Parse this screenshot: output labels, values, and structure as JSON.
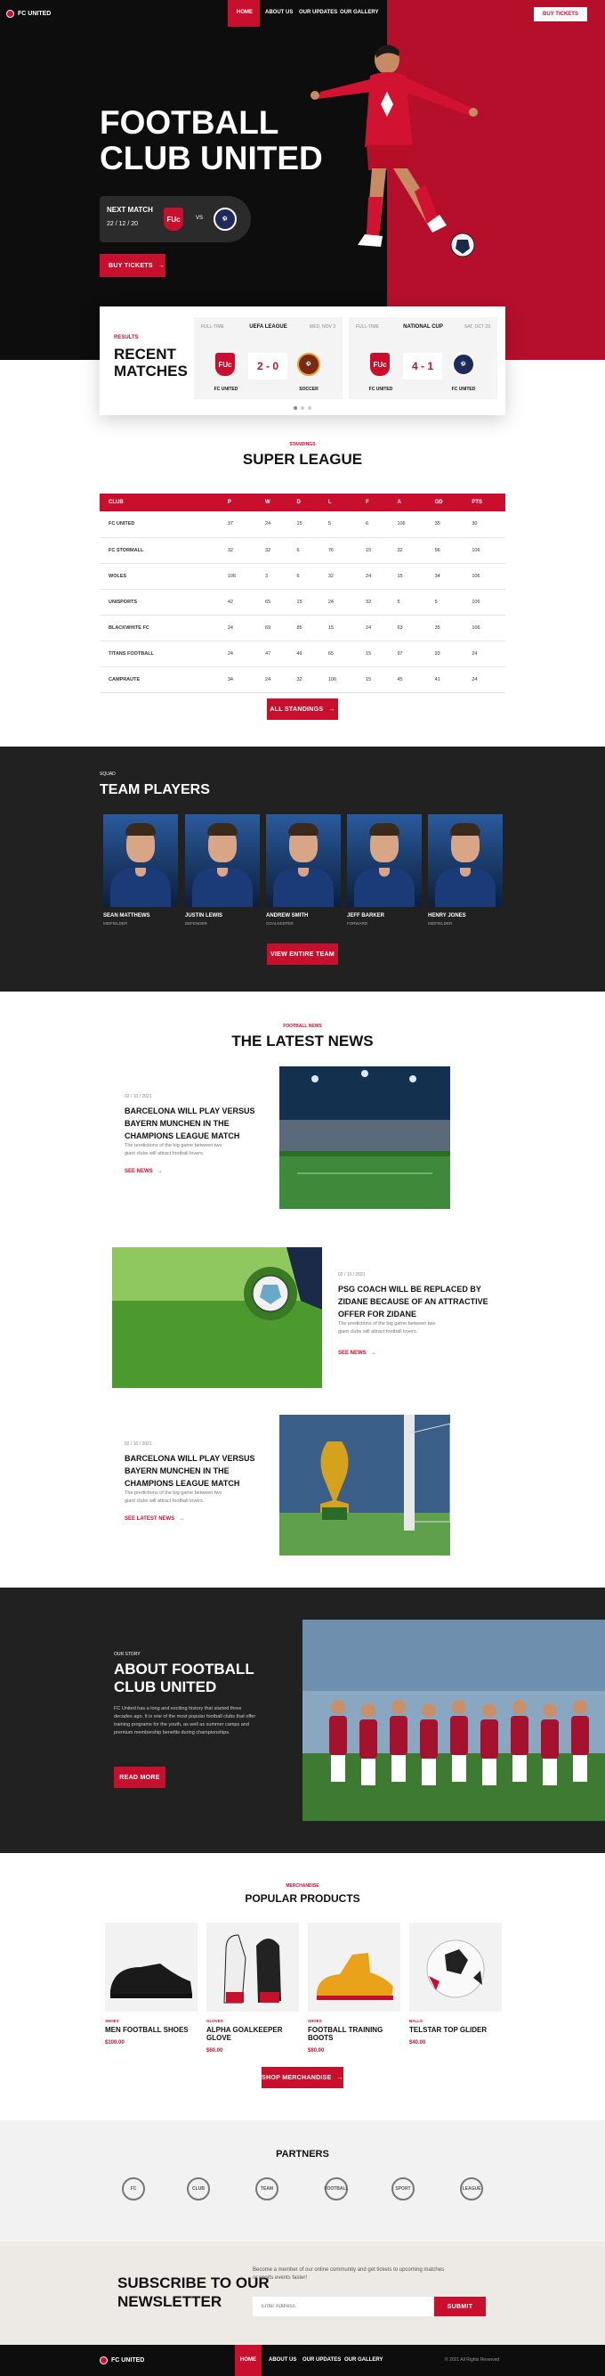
{
  "nav": {
    "brand": "FC UNITED",
    "items": [
      "HOME",
      "ABOUT US",
      "OUR UPDATES",
      "OUR GALLERY"
    ],
    "cta": "BUY TICKETS"
  },
  "hero": {
    "title_line1": "FOOTBALL",
    "title_line2": "CLUB UNITED",
    "next_match_label": "NEXT MATCH",
    "next_match_date": "22 / 12 / 20",
    "vs": "VS",
    "home_crest": "FUc",
    "buy_button": "BUY TICKETS"
  },
  "recent": {
    "kicker": "RESULTS",
    "title_line1": "RECENT",
    "title_line2": "MATCHES",
    "matches": [
      {
        "left_meta": "FULL-TIME",
        "competition": "UEFA LEAGUE",
        "right_meta": "WED, NOV 3",
        "score": "2 - 0",
        "team_a": "FC UNITED",
        "team_b": "SOCCER",
        "crest_a": "FUc"
      },
      {
        "left_meta": "FULL-TIME",
        "competition": "NATIONAL CUP",
        "right_meta": "SAT, OCT 23",
        "score": "4 - 1",
        "team_a": "FC UNITED",
        "team_b": "FC UNITED",
        "crest_a": "FUc"
      }
    ]
  },
  "standings": {
    "kicker": "STANDINGS",
    "title": "SUPER LEAGUE",
    "headers": [
      "CLUB",
      "P",
      "W",
      "D",
      "L",
      "F",
      "A",
      "GD",
      "PTS"
    ],
    "rows": [
      [
        "FC UNITED",
        "37",
        "24",
        "15",
        "5",
        "6",
        "106",
        "35",
        "30"
      ],
      [
        "FC STORMALL",
        "32",
        "32",
        "6",
        "76",
        "15",
        "32",
        "96",
        "106"
      ],
      [
        "WOLES",
        "106",
        "3",
        "6",
        "32",
        "24",
        "15",
        "34",
        "106"
      ],
      [
        "UNISPORTS",
        "42",
        "65",
        "15",
        "24",
        "32",
        "5",
        "5",
        "106"
      ],
      [
        "BLACKWHITE FC",
        "24",
        "69",
        "85",
        "15",
        "24",
        "63",
        "35",
        "106"
      ],
      [
        "TITANS FOOTBALL",
        "24",
        "47",
        "49",
        "65",
        "15",
        "97",
        "93",
        "24"
      ],
      [
        "CAMPRAUTE",
        "34",
        "24",
        "32",
        "106",
        "15",
        "45",
        "41",
        "24"
      ]
    ],
    "button": "ALL STANDINGS"
  },
  "players": {
    "kicker": "SQUAD",
    "title": "TEAM PLAYERS",
    "list": [
      {
        "name": "SEAN MATTHEWS",
        "position": "MIDFIELDER"
      },
      {
        "name": "JUSTIN LEWIS",
        "position": "DEFENDER"
      },
      {
        "name": "ANDREW SMITH",
        "position": "GOALKEEPER"
      },
      {
        "name": "JEFF BARKER",
        "position": "FORWARD"
      },
      {
        "name": "HENRY JONES",
        "position": "MIDFIELDER"
      }
    ],
    "button": "VIEW ENTIRE TEAM"
  },
  "news": {
    "kicker": "FOOTBALL NEWS",
    "title": "THE LATEST NEWS",
    "items": [
      {
        "date": "02 / 10 / 2021",
        "title": "BARCELONA WILL PLAY VERSUS BAYERN MUNCHEN IN THE CHAMPIONS LEAGUE MATCH",
        "desc": "The predictions of the big game between two giant clubs will attract football lovers.",
        "link": "SEE NEWS"
      },
      {
        "date": "02 / 10 / 2021",
        "title": "PSG COACH WILL BE REPLACED BY ZIDANE BECAUSE OF AN ATTRACTIVE OFFER FOR ZIDANE",
        "desc": "The predictions of the big game between two giant clubs will attract football lovers.",
        "link": "SEE NEWS"
      },
      {
        "date": "02 / 10 / 2021",
        "title": "BARCELONA WILL PLAY VERSUS BAYERN MUNCHEN IN THE CHAMPIONS LEAGUE MATCH",
        "desc": "The predictions of the big game between two giant clubs will attract football lovers.",
        "link": "SEE LATEST NEWS"
      }
    ]
  },
  "about": {
    "kicker": "OUR STORY",
    "title": "ABOUT FOOTBALL CLUB UNITED",
    "text": "FC United has a long and exciting history that started three decades ago. It is one of the most popular football clubs that offer training programs for the youth, as well as summer camps and premium membership benefits during championships.",
    "button": "READ MORE"
  },
  "products": {
    "kicker": "MERCHANDISE",
    "title": "POPULAR PRODUCTS",
    "items": [
      {
        "category": "SHOES",
        "name": "MEN FOOTBALL SHOES",
        "price": "$100.00"
      },
      {
        "category": "GLOVES",
        "name": "ALPHA GOALKEEPER GLOVE",
        "price": "$60.00"
      },
      {
        "category": "SHOES",
        "name": "FOOTBALL TRAINING BOOTS",
        "price": "$80.00"
      },
      {
        "category": "BALLS",
        "name": "TELSTAR TOP GLIDER",
        "price": "$40.00"
      }
    ],
    "button": "SHOP MERCHANDISE"
  },
  "partners": {
    "title": "PARTNERS",
    "logos": [
      "FC",
      "CLUB",
      "TEAM",
      "FOOTBALL",
      "SPORT",
      "LEAGUE"
    ]
  },
  "newsletter": {
    "title_line1": "SUBSCRIBE TO OUR",
    "title_line2": "NEWSLETTER",
    "text": "Become a member of our online community and get tickets to upcoming matches or sports events faster!",
    "placeholder": "Enter Address",
    "button": "SUBMIT"
  },
  "footer": {
    "brand": "FC UNITED",
    "items": [
      "HOME",
      "ABOUT US",
      "OUR UPDATES",
      "OUR GALLERY"
    ],
    "copyright": "© 2021 All Rights Reserved"
  },
  "colors": {
    "accent": "#c8102e",
    "dark": "#0d0d0d",
    "panel": "#212121"
  }
}
